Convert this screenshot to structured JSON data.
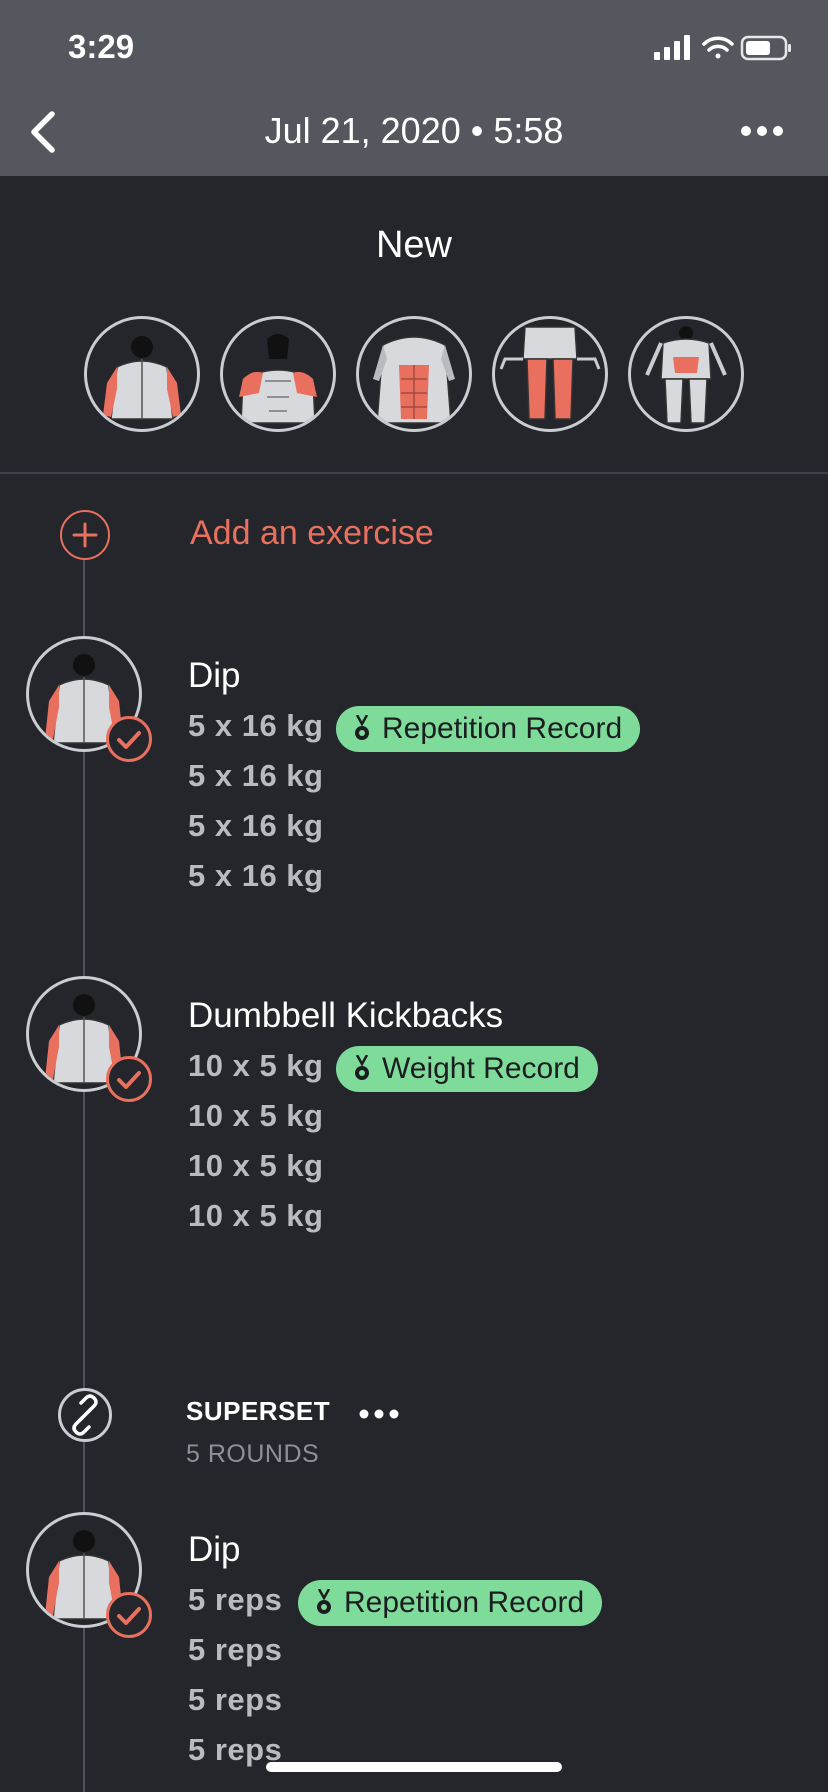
{
  "status_bar": {
    "time": "3:29"
  },
  "nav": {
    "title": "Jul 21, 2020 • 5:58",
    "back_icon": "chevron-left-icon",
    "more_icon": "ellipsis-icon"
  },
  "workout": {
    "title": "New",
    "muscle_groups": [
      {
        "name": "triceps-back"
      },
      {
        "name": "shoulders-front"
      },
      {
        "name": "abs"
      },
      {
        "name": "hamstrings"
      },
      {
        "name": "lower-back"
      }
    ]
  },
  "add_exercise": {
    "label": "Add an exercise",
    "icon": "plus-circle-icon"
  },
  "exercises": [
    {
      "name": "Dip",
      "sets": [
        "5 x 16 kg",
        "5 x 16 kg",
        "5 x 16 kg",
        "5 x 16 kg"
      ],
      "record": "Repetition Record"
    },
    {
      "name": "Dumbbell Kickbacks",
      "sets": [
        "10 x 5 kg",
        "10 x 5 kg",
        "10 x 5 kg",
        "10 x 5 kg"
      ],
      "record": "Weight Record"
    }
  ],
  "superset": {
    "title": "SUPERSET",
    "rounds": "5 ROUNDS",
    "exercises": [
      {
        "name": "Dip",
        "sets": [
          "5 reps",
          "5 reps",
          "5 reps",
          "5 reps"
        ],
        "record": "Repetition Record"
      }
    ]
  },
  "colors": {
    "background": "#24262b",
    "header": "#54585e",
    "accent": "#e9705e",
    "record_badge": "#7fdb9a",
    "muscle_highlight": "#e9705e"
  }
}
